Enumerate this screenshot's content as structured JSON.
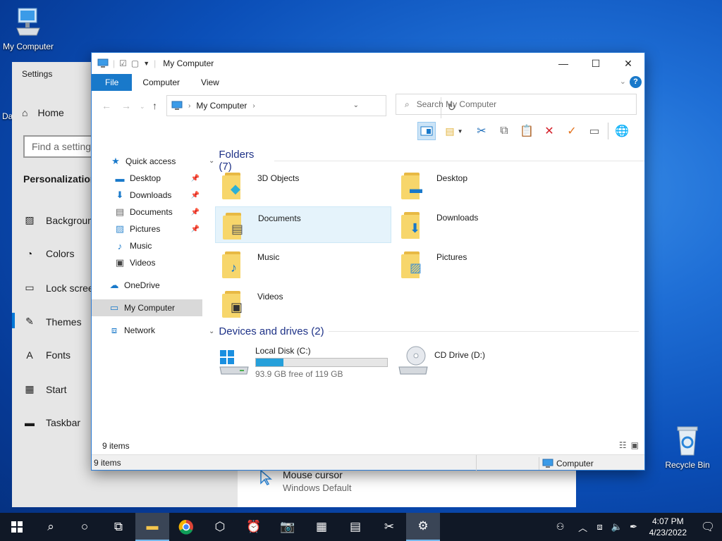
{
  "desktop": {
    "icons": [
      {
        "label": "My Computer",
        "icon": "computer-icon"
      },
      {
        "label": "Recycle Bin",
        "icon": "recycle-bin-icon"
      }
    ],
    "partial_label": "Da"
  },
  "settings": {
    "title": "Settings",
    "home": "Home",
    "search_placeholder": "Find a setting",
    "section": "Personalization",
    "items": [
      {
        "label": "Background",
        "icon": "image-icon"
      },
      {
        "label": "Colors",
        "icon": "palette-icon"
      },
      {
        "label": "Lock screen",
        "icon": "monitor-icon"
      },
      {
        "label": "Themes",
        "icon": "brush-icon"
      },
      {
        "label": "Fonts",
        "icon": "font-icon"
      },
      {
        "label": "Start",
        "icon": "start-tiles-icon"
      },
      {
        "label": "Taskbar",
        "icon": "taskbar-icon"
      }
    ],
    "active_item": "Themes",
    "mouse_cursor": {
      "title": "Mouse cursor",
      "value": "Windows Default"
    }
  },
  "explorer": {
    "title": "My Computer",
    "tabs": [
      "File",
      "Computer",
      "View"
    ],
    "address": "My Computer",
    "search_placeholder": "Search My Computer",
    "nav": {
      "quick_access": "Quick access",
      "pinned": [
        {
          "label": "Desktop",
          "pinned": true
        },
        {
          "label": "Downloads",
          "pinned": true
        },
        {
          "label": "Documents",
          "pinned": true
        },
        {
          "label": "Pictures",
          "pinned": true
        },
        {
          "label": "Music",
          "pinned": false
        },
        {
          "label": "Videos",
          "pinned": false
        }
      ],
      "onedrive": "OneDrive",
      "my_computer": "My Computer",
      "network": "Network"
    },
    "folders_header": "Folders (7)",
    "folders": [
      "3D Objects",
      "Desktop",
      "Documents",
      "Downloads",
      "Music",
      "Pictures",
      "Videos"
    ],
    "selected_folder": "Documents",
    "drives_header": "Devices and drives (2)",
    "drives": [
      {
        "name": "Local Disk (C:)",
        "free": "93.9 GB free of 119 GB",
        "used_fraction": 0.21
      },
      {
        "name": "CD Drive (D:)"
      }
    ],
    "item_count": "9 items",
    "status_left": "9 items",
    "status_right": "Computer"
  },
  "taskbar": {
    "time": "4:07 PM",
    "date": "4/23/2022"
  }
}
